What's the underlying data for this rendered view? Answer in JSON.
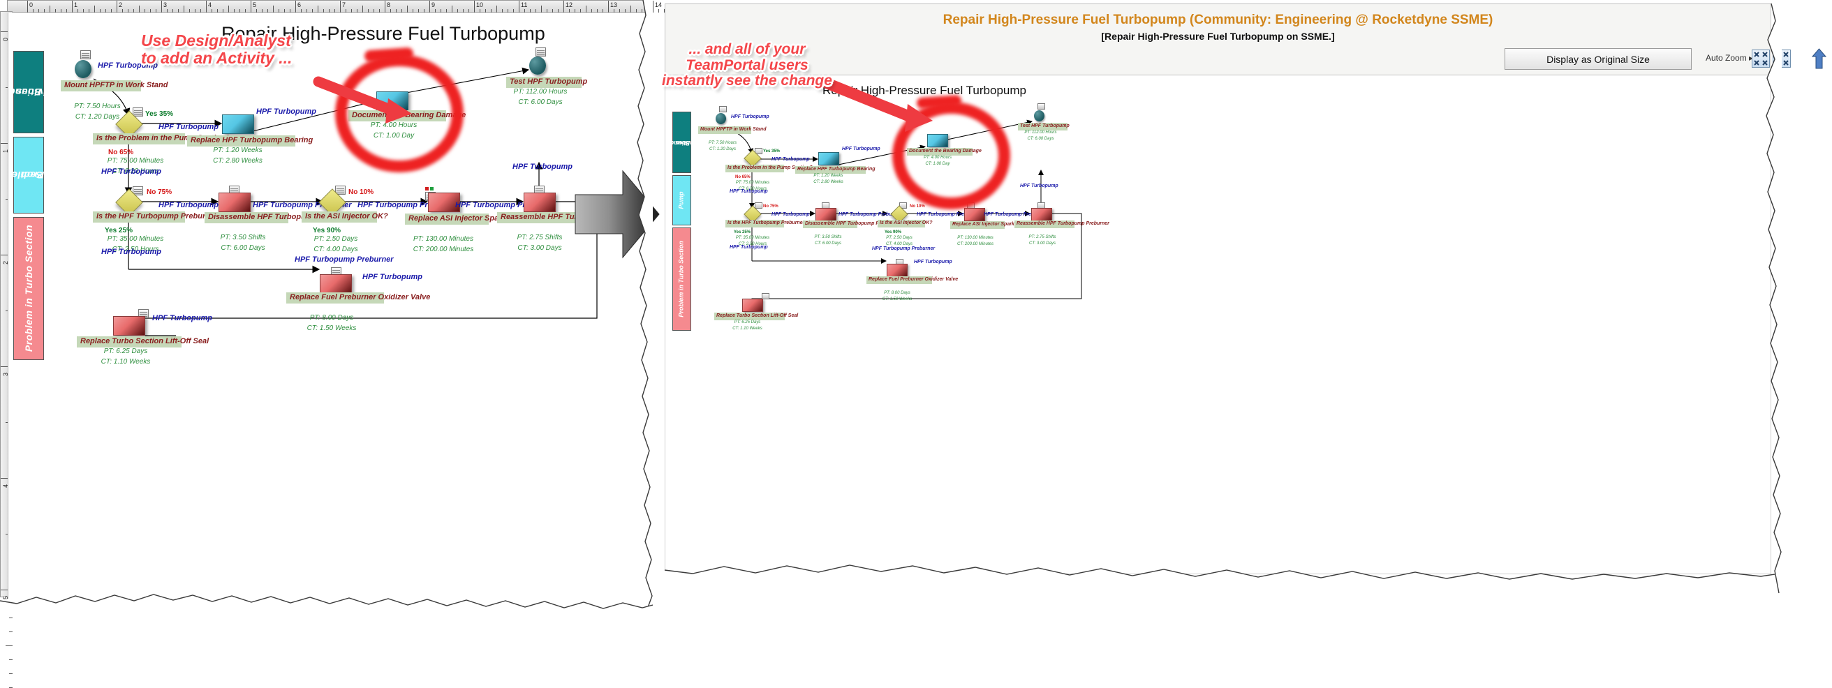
{
  "left_panel": {
    "diagram_title": "Repair High-Pressure Fuel Turbopump",
    "ruler": {
      "h_marks": [
        "0",
        "1",
        "2",
        "3",
        "4",
        "5",
        "6",
        "7",
        "8",
        "9",
        "10",
        "11",
        "12",
        "13",
        "14"
      ],
      "v_marks": [
        "0",
        "1",
        "2",
        "3",
        "4",
        "5"
      ]
    },
    "lanes": [
      {
        "id": "boundary",
        "line1": "Boundary",
        "line2": "Activities",
        "color": "#0e7f7f"
      },
      {
        "id": "pump",
        "line1": "Problem in",
        "line2": "Pump Section",
        "color": "#6fe6f3"
      },
      {
        "id": "turbo",
        "line1": "Problem in Turbo Section",
        "line2": "",
        "color": "#f58a8f"
      }
    ],
    "annotations": [
      {
        "id": "callout-design-analyst",
        "line1": "Use Design/Analyst",
        "line2": "to add an Activity ..."
      }
    ]
  },
  "flow": {
    "nodes": [
      {
        "id": "mount-hpftp",
        "type": "start",
        "label": "Mount HPFTP in Work Stand",
        "pt": "PT:  7.50 Hours",
        "ct": "CT: 1.20 Days"
      },
      {
        "id": "is-problem-pump-section",
        "type": "decision",
        "label": "Is the Problem in the Pump Section?",
        "pt": "PT:  75.00 Minutes",
        "ct": "CT: 6.20 Hours",
        "out_yes": "Yes  35%",
        "out_no": "No      65%"
      },
      {
        "id": "replace-hpf-bearing",
        "type": "activity",
        "label": "Replace HPF Turbopump Bearing",
        "pt": "PT:  1.20 Weeks",
        "ct": "CT: 2.80 Weeks"
      },
      {
        "id": "document-bearing-damage",
        "type": "activity",
        "label": "Document the Bearing Damage",
        "pt": "PT:  4.00 Hours",
        "ct": "CT: 1.00 Day"
      },
      {
        "id": "test-hpf-turbopump",
        "type": "activity",
        "label": "Test HPF Turbopump",
        "pt": "PT:  112.00 Hours",
        "ct": "CT: 6.00 Days"
      },
      {
        "id": "is-preburner-ok",
        "type": "decision",
        "label": "Is the HPF Turbopump Preburner OK?",
        "pt": "PT:  35.00 Minutes",
        "ct": "CT: 2.50 Hours",
        "out_yes": "Yes  25%",
        "out_no": "No  75%"
      },
      {
        "id": "disassemble-preburner",
        "type": "activity",
        "label": "Disassemble HPF Turbopump Preburner",
        "pt": "PT:  3.50 Shifts",
        "ct": "CT: 6.00 Days"
      },
      {
        "id": "is-asi-injector-ok",
        "type": "decision",
        "label": "Is the ASI Injector OK?",
        "pt": "PT:  2.50 Days",
        "ct": "CT: 4.00 Days",
        "out_yes": "Yes  90%",
        "out_no": "No    10%"
      },
      {
        "id": "replace-asi-spark-igniter",
        "type": "activity",
        "label": "Replace ASI Injector Spark Igniter",
        "pt": "PT:  130.00 Minutes",
        "ct": "CT: 200.00 Minutes"
      },
      {
        "id": "reassemble-preburner",
        "type": "activity",
        "label": "Reassemble HPF Turbopump Preburner",
        "pt": "PT:  2.75 Shifts",
        "ct": "CT: 3.00 Days"
      },
      {
        "id": "replace-fuel-preburner-oxidizer-valve",
        "type": "activity",
        "label": "Replace Fuel Preburner Oxidizer Valve",
        "pt": "PT:  8.00 Days",
        "ct": "CT: 1.50 Weeks"
      },
      {
        "id": "replace-turbo-lift-off-seal",
        "type": "activity",
        "label": "Replace Turbo Section Lift-Off Seal",
        "pt": "PT:  6.25 Days",
        "ct": "CT: 1.10 Weeks"
      }
    ],
    "edge_label": "HPF Turbopump",
    "edge_label_preburner": "HPF Turbopump Preburner"
  },
  "right_panel": {
    "header": {
      "title": "Repair High-Pressure Fuel Turbopump (Community: Engineering @ Rocketdyne SSME)",
      "subtitle": "[Repair High-Pressure Fuel Turbopump on SSME.]",
      "display_original_button": "Display as Original Size",
      "auto_zoom_label": "Auto Zoom",
      "zoom_out_icon": "zoom-out-icon",
      "zoom_in_icon": "zoom-in-icon",
      "scroll_updown_icon": "scroll-up-down-icon"
    },
    "doc_title": "Repair High-Pressure Fuel Turbopump",
    "annotations": [
      {
        "id": "callout-teamportal",
        "line1": "... and all of your",
        "line2": "TeamPortal users",
        "line3": "instantly see the change"
      }
    ],
    "lanes": [
      {
        "id": "boundary",
        "line1": "Boundary",
        "line2": "Activities",
        "color": "#0e7f7f"
      },
      {
        "id": "pump",
        "line1": "Pump",
        "line2": "",
        "color": "#6fe6f3"
      },
      {
        "id": "turbo",
        "line1": "Problem in Turbo Section",
        "line2": "",
        "color": "#f58a8f"
      }
    ]
  },
  "colors": {
    "annotation_red": "#f4464a",
    "ring_red": "#ee2222",
    "lane_boundary": "#0e7f7f",
    "lane_pump": "#6fe6f3",
    "lane_turbo": "#f58a8f",
    "node_label_bg": "#c5d8b8",
    "node_label_text": "#8a2020",
    "ptct_text": "#2f8f3f",
    "edge_label_text": "#1a1aaa",
    "header_title": "#d2861c"
  }
}
